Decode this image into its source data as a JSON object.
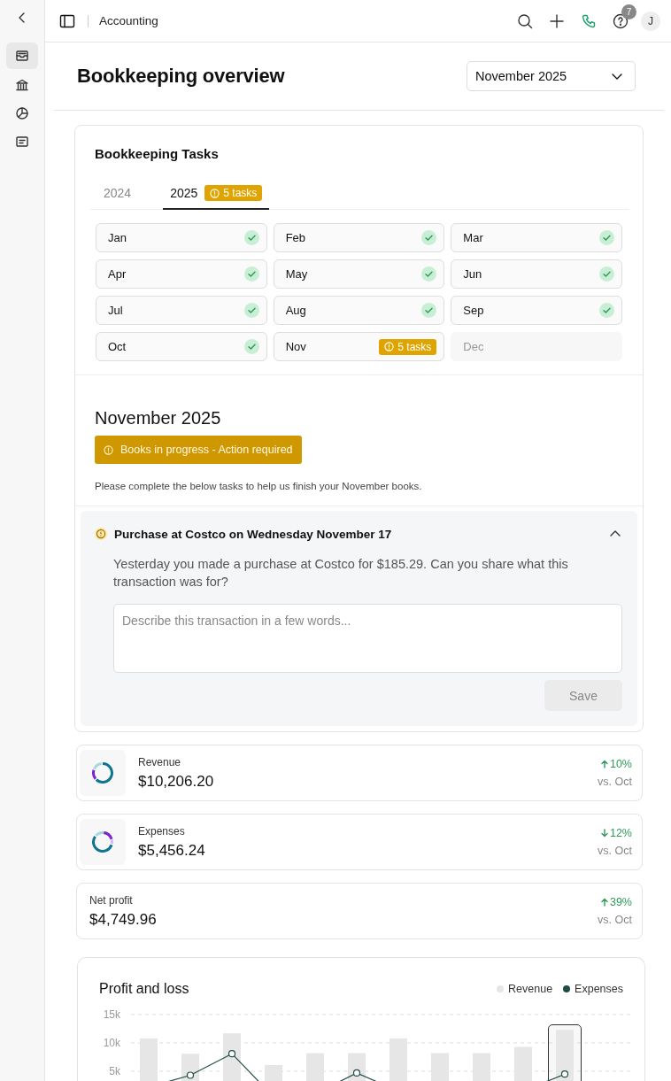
{
  "sidebar": {
    "items": [
      {
        "kind": "inbox",
        "selected": true
      },
      {
        "kind": "bank",
        "selected": false
      },
      {
        "kind": "pie",
        "selected": false
      },
      {
        "kind": "receipt",
        "selected": false
      }
    ]
  },
  "topbar": {
    "title": "Accounting",
    "help_badge": "7",
    "avatar": "J"
  },
  "page": {
    "title": "Bookkeeping overview",
    "period": "November 2025"
  },
  "tasks_card": {
    "title": "Bookkeeping Tasks",
    "tabs": [
      {
        "label": "2024",
        "selected": false
      },
      {
        "label": "2025",
        "selected": true,
        "badge": "5 tasks"
      }
    ],
    "months": [
      {
        "label": "Jan",
        "completed": true,
        "disabled": false
      },
      {
        "label": "Feb",
        "completed": true,
        "disabled": false
      },
      {
        "label": "Mar",
        "completed": true,
        "disabled": false
      },
      {
        "label": "Apr",
        "completed": true,
        "disabled": false
      },
      {
        "label": "May",
        "completed": true,
        "disabled": false
      },
      {
        "label": "Jun",
        "completed": true,
        "disabled": false
      },
      {
        "label": "Jul",
        "completed": true,
        "disabled": false
      },
      {
        "label": "Aug",
        "completed": true,
        "disabled": false
      },
      {
        "label": "Sep",
        "completed": true,
        "disabled": false
      },
      {
        "label": "Oct",
        "completed": true,
        "disabled": false
      },
      {
        "label": "Nov",
        "completed": false,
        "disabled": false,
        "badge": "5 tasks"
      },
      {
        "label": "Dec",
        "completed": false,
        "disabled": true
      }
    ]
  },
  "month_detail": {
    "title": "November 2025",
    "status": "Books in progress - Action required",
    "note": "Please complete the below tasks to help us finish your November books."
  },
  "task": {
    "title": "Purchase at Costco on Wednesday November 17",
    "expanded": true,
    "question": "Yesterday you made a purchase at Costco for $185.29. Can you share what this transaction was for?",
    "placeholder": "Describe this transaction in a few words...",
    "button": "Save",
    "button_disabled": true
  },
  "metrics": [
    {
      "kind": "donut",
      "label": "Revenue",
      "value": "$10,206.20",
      "increase": true,
      "change": "10%",
      "compare": "vs. Oct"
    },
    {
      "kind": "donut",
      "label": "Expenses",
      "value": "$5,456.24",
      "increase": false,
      "change": "12%",
      "compare": "vs. Oct"
    },
    {
      "kind": "plain",
      "label": "Net profit",
      "value": "$4,749.96",
      "increase": true,
      "change": "39%",
      "compare": "vs. Oct"
    }
  ],
  "chart": {
    "title": "Profit and loss",
    "highlight_last": true,
    "chart_data": {
      "type": "bar",
      "yticks": [
        {
          "value": 5000,
          "label": "5k"
        },
        {
          "value": 10000,
          "label": "10k"
        },
        {
          "value": 15000,
          "label": "15k"
        }
      ],
      "ylim": [
        0,
        15000
      ],
      "series": [
        {
          "name": "Revenue",
          "color": "#e6e6e6",
          "values": [
            10800,
            8100,
            11700,
            6100,
            8200,
            8200,
            10800,
            8200,
            8200,
            9300,
            12300
          ]
        },
        {
          "name": "Expenses",
          "type": "line",
          "marker": "o",
          "color": "#1f4d45",
          "values": [
            2200,
            4300,
            8100,
            500,
            1000,
            4700,
            1500,
            800,
            800,
            1500,
            4500
          ]
        }
      ]
    }
  }
}
